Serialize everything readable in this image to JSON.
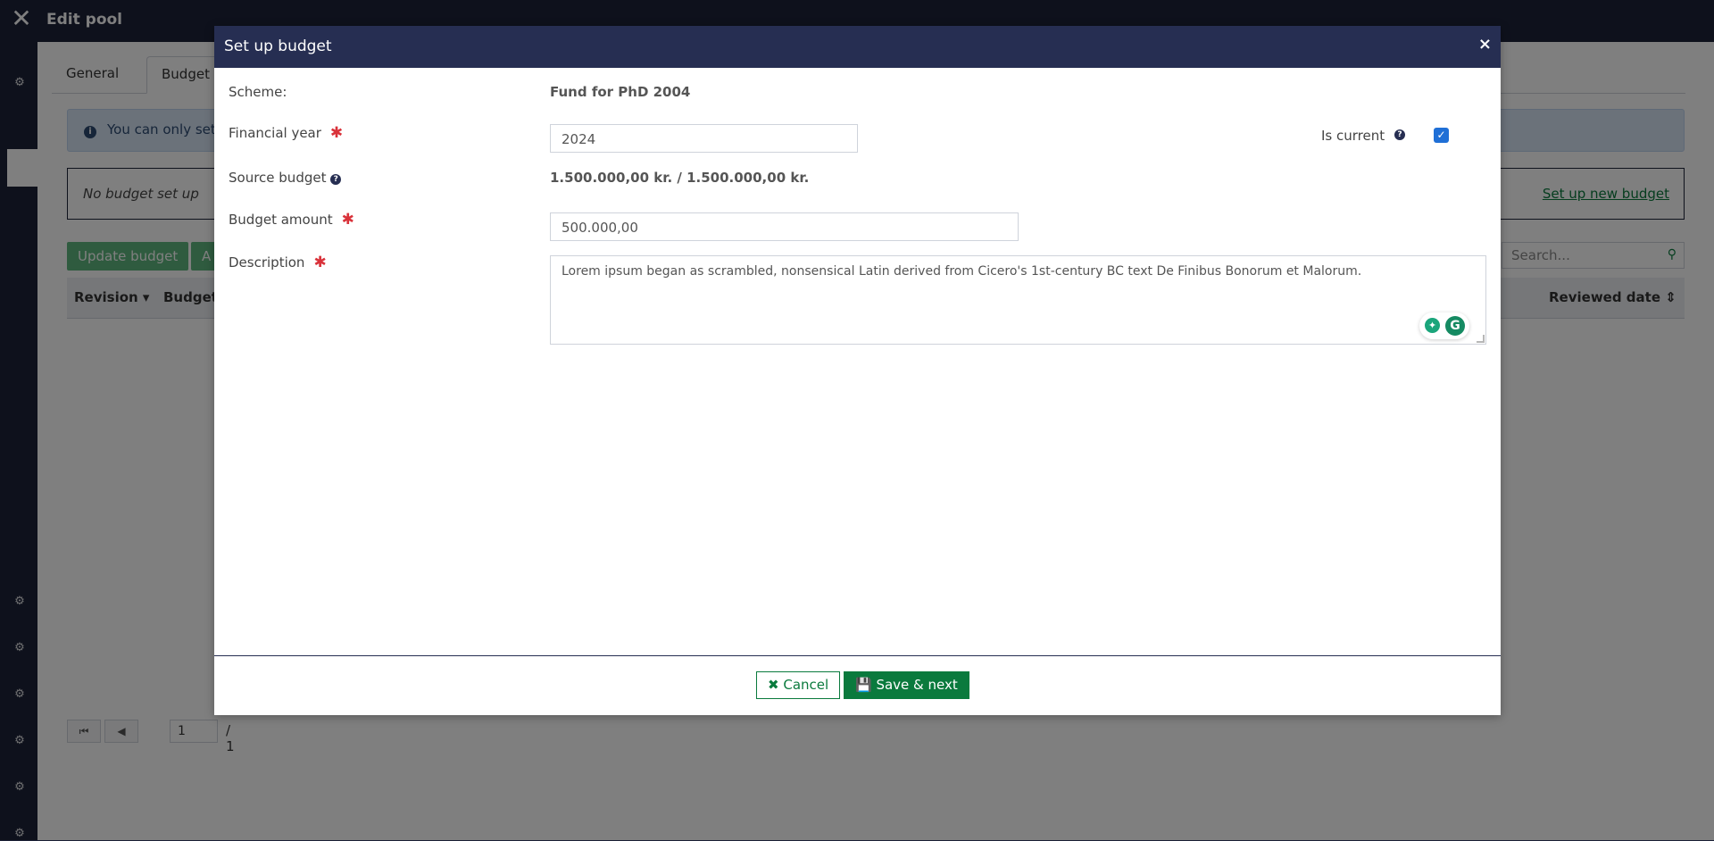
{
  "app": {
    "title": "Edit pool",
    "tabs": [
      {
        "label": "General"
      },
      {
        "label": "Budget"
      }
    ],
    "info_text": "You can only set",
    "empty_text": "No budget set up",
    "setup_link": "Set up new budget",
    "actions": [
      {
        "label": "Update budget"
      },
      {
        "label": "A"
      }
    ],
    "search_placeholder": "Search...",
    "columns": [
      {
        "label": "Revision ▾"
      },
      {
        "label": "Budget"
      },
      {
        "label": "Reviewed date ⇕"
      }
    ],
    "pager": {
      "page": "1",
      "total": "/ 1"
    }
  },
  "modal": {
    "title": "Set up budget",
    "close_symbol": "×",
    "scheme_label": "Scheme:",
    "scheme_value": "Fund for PhD 2004",
    "financial_year_label": "Financial year",
    "financial_year_value": "2024",
    "is_current_label": "Is current",
    "is_current_checked": true,
    "source_budget_label": "Source budget",
    "source_budget_value": "1.500.000,00 kr. / 1.500.000,00 kr.",
    "budget_amount_label": "Budget amount",
    "budget_amount_value": "500.000,00",
    "description_label": "Description",
    "description_value": "Lorem ipsum began as scrambled, nonsensical Latin derived from Cicero's 1st-century BC text De Finibus Bonorum et Malorum.",
    "required_symbol": "✱",
    "cancel_label": "Cancel",
    "save_label": "Save & next"
  },
  "colors": {
    "header_bg": "#262e52",
    "primary_green": "#0a7a3d",
    "required_red": "#d9323a",
    "checkbox_blue": "#1f6fd6"
  }
}
